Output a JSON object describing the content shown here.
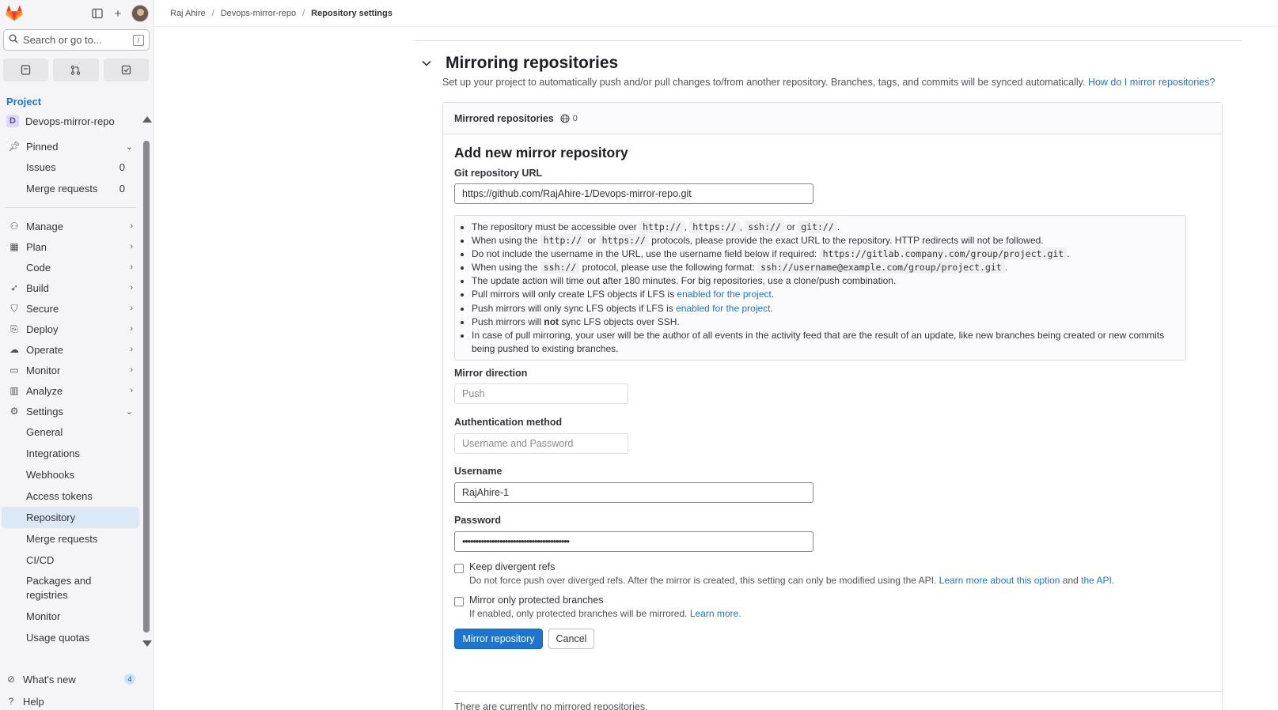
{
  "topbar": {
    "breadcrumbs": [
      "Raj Ahire",
      "Devops-mirror-repo",
      "Repository settings"
    ]
  },
  "sidebar": {
    "search_placeholder": "Search or go to...",
    "search_shortcut": "/",
    "section_title": "Project",
    "project_initial": "D",
    "project_name": "Devops-mirror-repo",
    "pinned": {
      "label": "Pinned",
      "items": [
        {
          "label": "Issues",
          "count": "0"
        },
        {
          "label": "Merge requests",
          "count": "0"
        }
      ]
    },
    "groups": [
      {
        "label": "Manage",
        "icon": "users-icon"
      },
      {
        "label": "Plan",
        "icon": "calendar-icon"
      },
      {
        "label": "Code",
        "icon": "code-icon"
      },
      {
        "label": "Build",
        "icon": "rocket-icon"
      },
      {
        "label": "Secure",
        "icon": "shield-icon"
      },
      {
        "label": "Deploy",
        "icon": "deploy-icon"
      },
      {
        "label": "Operate",
        "icon": "cloud-icon"
      },
      {
        "label": "Monitor",
        "icon": "monitor-icon"
      },
      {
        "label": "Analyze",
        "icon": "chart-icon"
      }
    ],
    "settings": {
      "label": "Settings",
      "items": [
        "General",
        "Integrations",
        "Webhooks",
        "Access tokens",
        "Repository",
        "Merge requests",
        "CI/CD",
        "Packages and registries",
        "Monitor",
        "Usage quotas"
      ],
      "active": "Repository"
    },
    "bottom": {
      "whats_new": "What's new",
      "whats_new_count": "4",
      "help": "Help"
    }
  },
  "section": {
    "title": "Mirroring repositories",
    "description": "Set up your project to automatically push and/or pull changes to/from another repository. Branches, tags, and commits will be synced automatically.",
    "help_link": "How do I mirror repositories?"
  },
  "card": {
    "header": "Mirrored repositories",
    "mirror_count": "0",
    "form_title": "Add new mirror repository",
    "git_url_label": "Git repository URL",
    "git_url_value": "https://github.com/RajAhire-1/Devops-mirror-repo.git",
    "info": {
      "l1_a": "The repository must be accessible over",
      "l1_c1": "http://",
      "l1_c2": "https://",
      "l1_c3": "ssh://",
      "l1_or": "or",
      "l1_c4": "git://",
      "l2_a": "When using the",
      "l2_c1": "http://",
      "l2_or": "or",
      "l2_c2": "https://",
      "l2_b": "protocols, please provide the exact URL to the repository. HTTP redirects will not be followed.",
      "l3_a": "Do not include the username in the URL, use the username field below if required:",
      "l3_c": "https://gitlab.company.com/group/project.git",
      "l4_a": "When using the",
      "l4_c1": "ssh://",
      "l4_b": "protocol, please use the following format:",
      "l4_c2": "ssh://username@example.com/group/project.git",
      "l5": "The update action will time out after 180 minutes. For big repositories, use a clone/push combination.",
      "l6_a": "Pull mirrors will only create LFS objects if LFS is",
      "l6_link": "enabled for the project",
      "l7_a": "Push mirrors will only sync LFS objects if LFS is",
      "l7_link": "enabled for the project",
      "l8_a": "Push mirrors will",
      "l8_b": "not",
      "l8_c": "sync LFS objects over SSH.",
      "l9": "In case of pull mirroring, your user will be the author of all events in the activity feed that are the result of an update, like new branches being created or new commits being pushed to existing branches."
    },
    "direction_label": "Mirror direction",
    "direction_value": "Push",
    "auth_label": "Authentication method",
    "auth_value": "Username and Password",
    "username_label": "Username",
    "username_value": "RajAhire-1",
    "password_label": "Password",
    "password_value": "••••••••••••••••••••••••••••••••••••••••",
    "keep_divergent": {
      "label": "Keep divergent refs",
      "help": "Do not force push over diverged refs. After the mirror is created, this setting can only be modified using the API.",
      "link1": "Learn more about this option",
      "and": "and",
      "link2": "the API"
    },
    "protected_only": {
      "label": "Mirror only protected branches",
      "help": "If enabled, only protected branches will be mirrored.",
      "link": "Learn more."
    },
    "submit_label": "Mirror repository",
    "cancel_label": "Cancel",
    "empty_text": "There are currently no mirrored repositories."
  }
}
